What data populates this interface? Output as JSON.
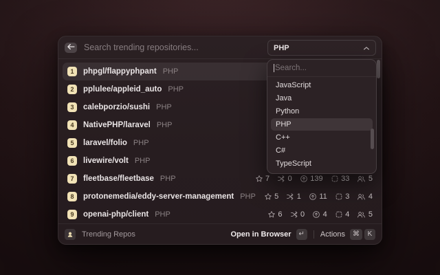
{
  "header": {
    "search_placeholder": "Search trending repositories..."
  },
  "language_dropdown": {
    "selected_value": "PHP",
    "search_placeholder": "Search...",
    "highlighted_option": "PHP",
    "options": [
      "JavaScript",
      "Java",
      "Python",
      "PHP",
      "C++",
      "C#",
      "TypeScript"
    ]
  },
  "repos": [
    {
      "rank": "1",
      "name": "phpgl/flappyphpant",
      "language": "PHP",
      "selected": true,
      "stats": null
    },
    {
      "rank": "2",
      "name": "pplulee/appleid_auto",
      "language": "PHP",
      "selected": false,
      "stats": null
    },
    {
      "rank": "3",
      "name": "calebporzio/sushi",
      "language": "PHP",
      "selected": false,
      "stats": null
    },
    {
      "rank": "4",
      "name": "NativePHP/laravel",
      "language": "PHP",
      "selected": false,
      "stats": null
    },
    {
      "rank": "5",
      "name": "laravel/folio",
      "language": "PHP",
      "selected": false,
      "stats": null
    },
    {
      "rank": "6",
      "name": "livewire/volt",
      "language": "PHP",
      "selected": false,
      "stats": null
    },
    {
      "rank": "7",
      "name": "fleetbase/fleetbase",
      "language": "PHP",
      "selected": false,
      "stats": {
        "star": "7",
        "fork": "0",
        "arrow_up_circle": "139",
        "issue": "33",
        "contributors": "5"
      }
    },
    {
      "rank": "8",
      "name": "protonemedia/eddy-server-management",
      "language": "PHP",
      "selected": false,
      "stats": {
        "star": "5",
        "fork": "1",
        "arrow_up_circle": "11",
        "issue": "3",
        "contributors": "4"
      }
    },
    {
      "rank": "9",
      "name": "openai-php/client",
      "language": "PHP",
      "selected": false,
      "stats": {
        "star": "6",
        "fork": "0",
        "arrow_up_circle": "4",
        "issue": "4",
        "contributors": "5"
      }
    }
  ],
  "footer": {
    "extension_name": "Trending Repos",
    "primary_action": "Open in Browser",
    "primary_action_key": "↵",
    "actions_label": "Actions",
    "actions_keys": [
      "⌘",
      "K"
    ]
  },
  "colors": {
    "rank_badge_bg": "#f1e2b6",
    "page_bg": "#2b191c",
    "window_bg": "#271d20",
    "selection": "rgba(255,255,255,0.08)"
  }
}
